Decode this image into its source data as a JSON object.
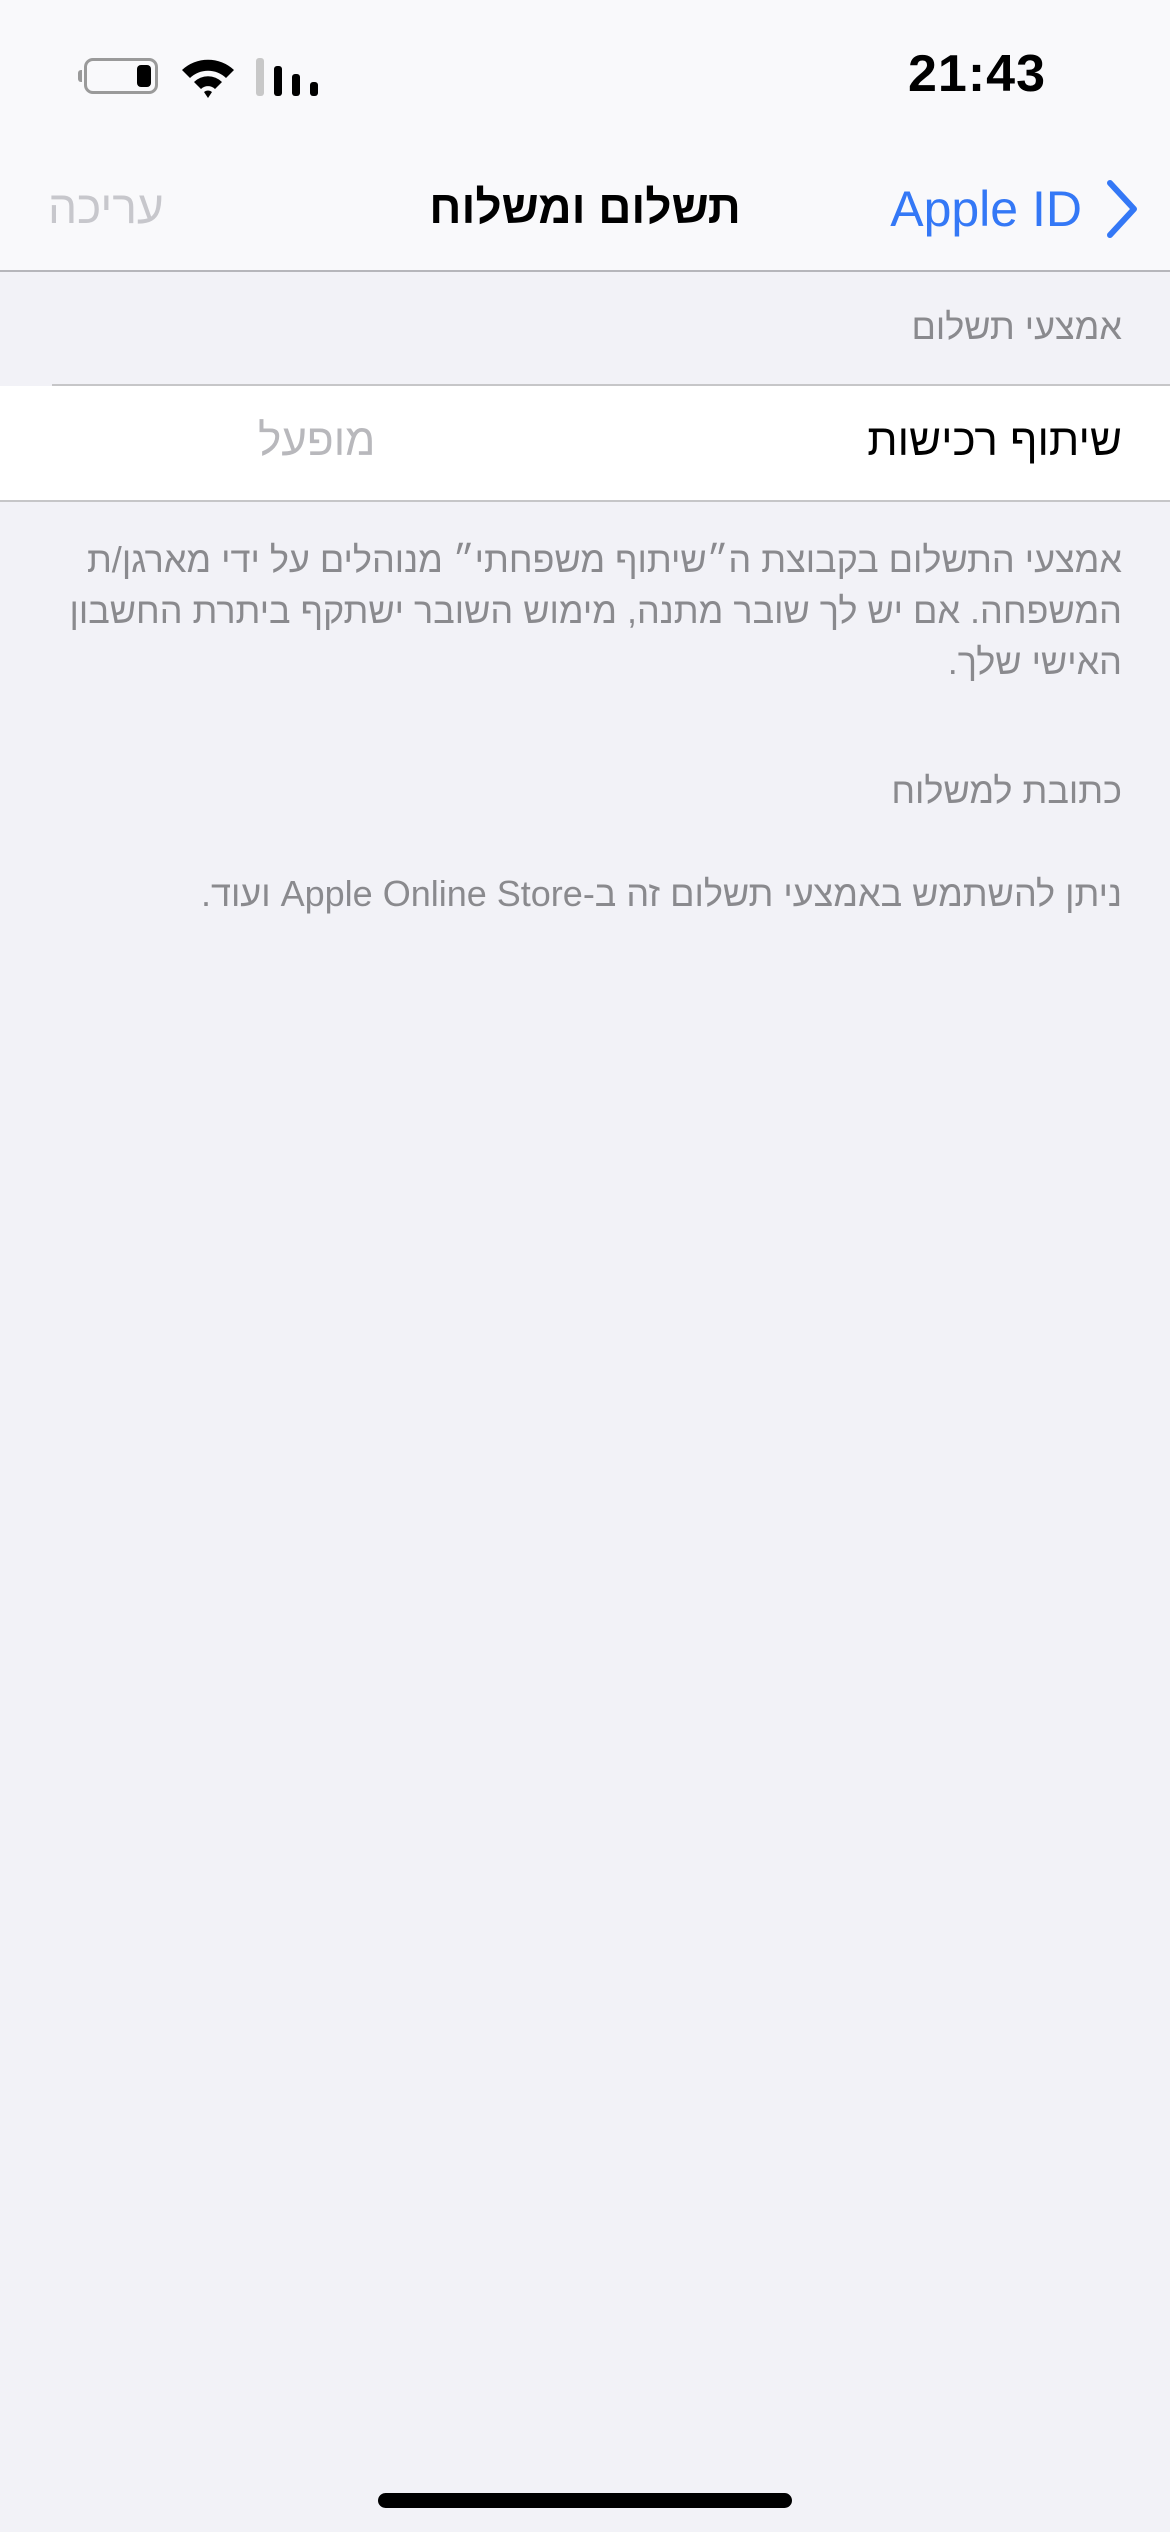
{
  "status_bar": {
    "time": "21:43",
    "icons": [
      "battery-icon",
      "wifi-icon",
      "cellular-signal-icon"
    ]
  },
  "nav": {
    "title": "תשלום ומשלוח",
    "back_label": "Apple ID",
    "back_icon": "chevron-right-icon",
    "edit_label": "עריכה"
  },
  "payment_section": {
    "header": "אמצעי תשלום",
    "row": {
      "label": "שיתוף רכישות",
      "value": "מופעל"
    },
    "footer": "אמצעי התשלום בקבוצת ה״שיתוף משפחתי״ מנוהלים על ידי מארגן/ת המשפחה. אם יש לך שובר מתנה, מימוש השובר ישתקף ביתרת החשבון האישי שלך."
  },
  "shipping_section": {
    "header": "כתובת למשלוח"
  },
  "footer_note": "ניתן להשתמש באמצעי תשלום זה ב-Apple Online Store ועוד.",
  "colors": {
    "accent": "#3478f6",
    "background": "#f2f2f7",
    "secondary_text": "#8a8a8e",
    "disabled_text": "#c7c7cc"
  }
}
